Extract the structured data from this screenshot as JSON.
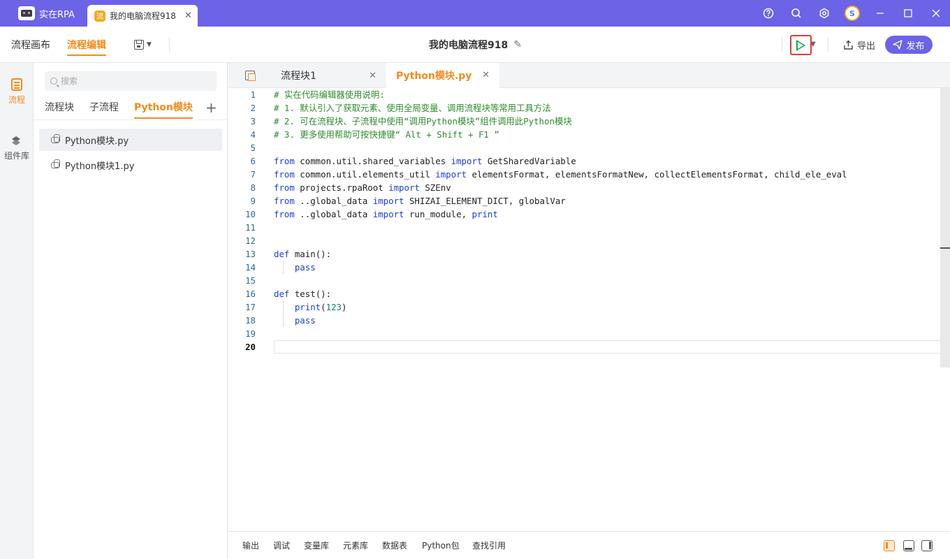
{
  "titlebar": {
    "app_name": "实在RPA",
    "doc_tab_label": "我的电脑流程918",
    "doc_tab_icon": "流",
    "avatar_letter": "S",
    "accent_color": "#6c63e6"
  },
  "toolbar": {
    "canvas_label": "流程画布",
    "edit_label": "流程编辑",
    "flow_title": "我的电脑流程918",
    "export_label": "导出",
    "publish_label": "发布"
  },
  "rail": {
    "items": [
      {
        "label": "流程",
        "icon": "list-icon"
      },
      {
        "label": "组件库",
        "icon": "layers-icon"
      }
    ]
  },
  "panel": {
    "search_placeholder": "搜索",
    "tabs": [
      "流程块",
      "子流程",
      "Python模块"
    ],
    "active_tab": "Python模块",
    "files": [
      "Python模块.py",
      "Python模块1.py"
    ],
    "selected_file": "Python模块.py"
  },
  "editor": {
    "tabs": [
      "流程块1",
      "Python模块.py"
    ],
    "active_tab": "Python模块.py",
    "current_line": 20,
    "lines": [
      [
        [
          "c-com",
          "# 实在代码编辑器使用说明:"
        ]
      ],
      [
        [
          "c-com",
          "# 1. 默认引入了获取元素、使用全局变量、调用流程块等常用工具方法"
        ]
      ],
      [
        [
          "c-com",
          "# 2. 可在流程块、子流程中使用“调用Python模块”组件调用此Python模块"
        ]
      ],
      [
        [
          "c-com",
          "# 3. 更多使用帮助可按快捷键“ Alt + Shift + F1 ”"
        ]
      ],
      [],
      [
        [
          "c-kw",
          "from"
        ],
        [
          "",
          " common.util.shared_variables "
        ],
        [
          "c-kw",
          "import"
        ],
        [
          "",
          " GetSharedVariable"
        ]
      ],
      [
        [
          "c-kw",
          "from"
        ],
        [
          "",
          " common.util.elements_util "
        ],
        [
          "c-kw",
          "import"
        ],
        [
          "",
          " elementsFormat, elementsFormatNew, collectElementsFormat, child_ele_eval"
        ]
      ],
      [
        [
          "c-kw",
          "from"
        ],
        [
          "",
          " projects.rpaRoot "
        ],
        [
          "c-kw",
          "import"
        ],
        [
          "",
          " SZEnv"
        ]
      ],
      [
        [
          "c-kw",
          "from"
        ],
        [
          "",
          " ..global_data "
        ],
        [
          "c-kw",
          "import"
        ],
        [
          "",
          " SHIZAI_ELEMENT_DICT, globalVar"
        ]
      ],
      [
        [
          "c-kw",
          "from"
        ],
        [
          "",
          " ..global_data "
        ],
        [
          "c-kw",
          "import"
        ],
        [
          "",
          " run_module, "
        ],
        [
          "c-fn",
          "print"
        ]
      ],
      [],
      [],
      [
        [
          "c-kw",
          "def"
        ],
        [
          "",
          " main():"
        ]
      ],
      [
        [
          "",
          "    "
        ],
        [
          "c-kw",
          "pass"
        ]
      ],
      [],
      [
        [
          "c-kw",
          "def"
        ],
        [
          "",
          " test():"
        ]
      ],
      [
        [
          "",
          "    "
        ],
        [
          "c-fn",
          "print"
        ],
        [
          "",
          "("
        ],
        [
          "c-num",
          "123"
        ],
        [
          "",
          ")"
        ]
      ],
      [
        [
          "",
          "    "
        ],
        [
          "c-kw",
          "pass"
        ]
      ],
      [],
      []
    ]
  },
  "bottombar": {
    "tabs": [
      "输出",
      "调试",
      "变量库",
      "元素库",
      "数据表",
      "Python包",
      "查找引用"
    ]
  }
}
